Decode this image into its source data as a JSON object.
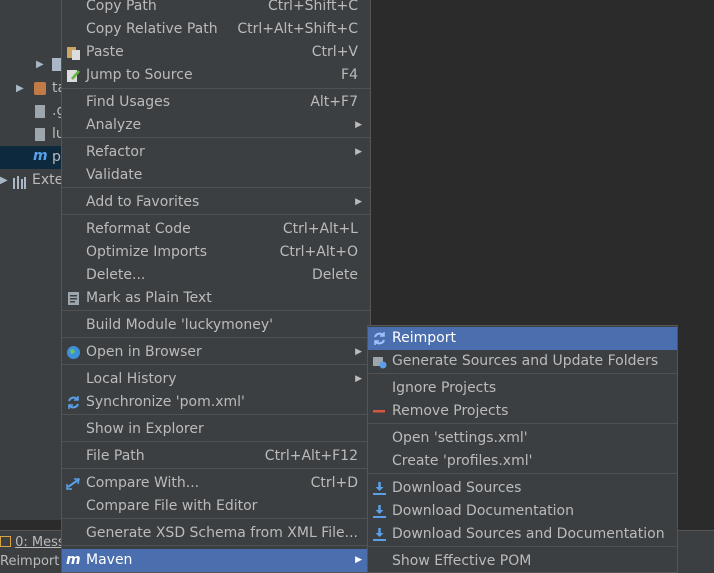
{
  "tree": {
    "items": [
      {
        "label": ""
      },
      {
        "label": "ta"
      },
      {
        "label": ".g"
      },
      {
        "label": "lu"
      },
      {
        "label": "p"
      },
      {
        "label": "Exte"
      }
    ]
  },
  "bottom": {
    "messages_tab": "0: Mess",
    "run_label": "Reimport"
  },
  "menu": {
    "copy_path": {
      "label": "Copy Path",
      "shortcut": "Ctrl+Shift+C"
    },
    "copy_relative_path": {
      "label": "Copy Relative Path",
      "shortcut": "Ctrl+Alt+Shift+C"
    },
    "paste": {
      "label": "Paste",
      "shortcut": "Ctrl+V"
    },
    "jump_to_source": {
      "label": "Jump to Source",
      "shortcut": "F4"
    },
    "find_usages": {
      "label": "Find Usages",
      "shortcut": "Alt+F7"
    },
    "analyze": {
      "label": "Analyze"
    },
    "refactor": {
      "label": "Refactor"
    },
    "validate": {
      "label": "Validate"
    },
    "add_to_favorites": {
      "label": "Add to Favorites"
    },
    "reformat_code": {
      "label": "Reformat Code",
      "shortcut": "Ctrl+Alt+L"
    },
    "optimize_imports": {
      "label": "Optimize Imports",
      "shortcut": "Ctrl+Alt+O"
    },
    "delete": {
      "label": "Delete...",
      "shortcut": "Delete"
    },
    "mark_as_plain_text": {
      "label": "Mark as Plain Text"
    },
    "build_module": {
      "label": "Build Module 'luckymoney'"
    },
    "open_in_browser": {
      "label": "Open in Browser"
    },
    "local_history": {
      "label": "Local History"
    },
    "synchronize": {
      "label": "Synchronize 'pom.xml'"
    },
    "show_in_explorer": {
      "label": "Show in Explorer"
    },
    "file_path": {
      "label": "File Path",
      "shortcut": "Ctrl+Alt+F12"
    },
    "compare_with": {
      "label": "Compare With...",
      "shortcut": "Ctrl+D"
    },
    "compare_file_with_editor": {
      "label": "Compare File with Editor"
    },
    "generate_xsd": {
      "label": "Generate XSD Schema from XML File..."
    },
    "maven": {
      "label": "Maven"
    }
  },
  "submenu": {
    "reimport": "Reimport",
    "generate_sources": "Generate Sources and Update Folders",
    "ignore_projects": "Ignore Projects",
    "remove_projects": "Remove Projects",
    "open_settings": "Open 'settings.xml'",
    "create_profiles": "Create 'profiles.xml'",
    "download_sources": "Download Sources",
    "download_documentation": "Download Documentation",
    "download_sources_and_docs": "Download Sources and Documentation",
    "show_effective_pom": "Show Effective POM"
  },
  "colors": {
    "panel": "#3c3f41",
    "editor": "#2b2b2b",
    "highlight": "#4b6eaf",
    "text": "#bbbbbb"
  },
  "icons": [
    "paste-icon",
    "jump-to-source-icon",
    "mark-plain-text-icon",
    "browser-globe-icon",
    "synchronize-icon",
    "compare-arrows-icon",
    "maven-icon",
    "reimport-icon",
    "generate-sources-icon",
    "remove-dash-icon",
    "download-icon"
  ]
}
